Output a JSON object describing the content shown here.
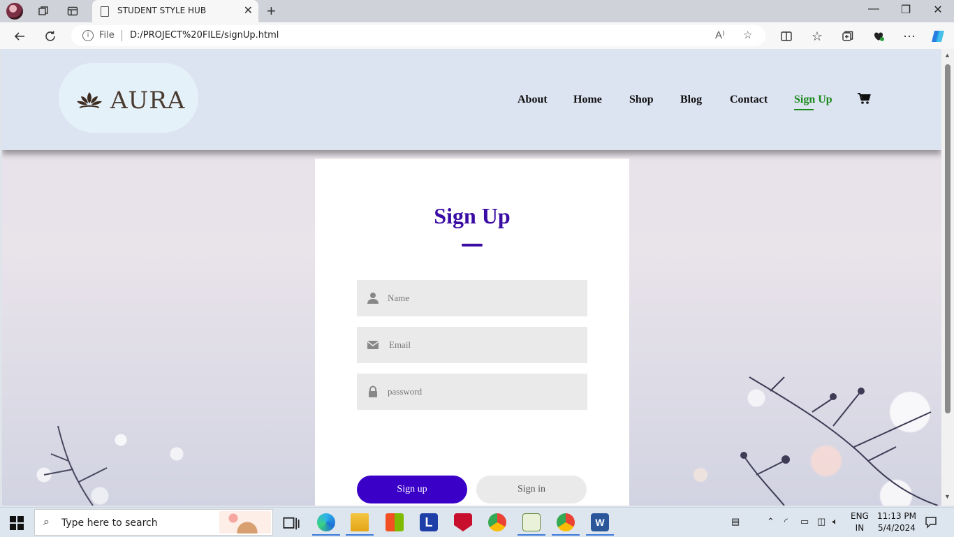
{
  "browser": {
    "tab_title": "STUDENT STYLE HUB",
    "url_scheme": "File",
    "url": "D:/PROJECT%20FILE/signUp.html"
  },
  "site": {
    "logo_text": "AURA",
    "nav": [
      "About",
      "Home",
      "Shop",
      "Blog",
      "Contact",
      "Sign Up"
    ],
    "active_nav": "Sign Up",
    "colors": {
      "accent": "#3a0ca3",
      "button": "#3a00c8",
      "nav_active": "#1a8a1a",
      "header_bg": "#dce3f1"
    }
  },
  "form": {
    "title": "Sign Up",
    "fields": [
      {
        "icon": "user-icon",
        "placeholder": "Name"
      },
      {
        "icon": "envelope-icon",
        "placeholder": "Email"
      },
      {
        "icon": "lock-icon",
        "placeholder": "password"
      }
    ],
    "signup_label": "Sign up",
    "signin_label": "Sign in"
  },
  "taskbar": {
    "search_placeholder": "Type here to search",
    "lang_line1": "ENG",
    "lang_line2": "IN",
    "time": "11:13 PM",
    "date": "5/4/2024"
  }
}
